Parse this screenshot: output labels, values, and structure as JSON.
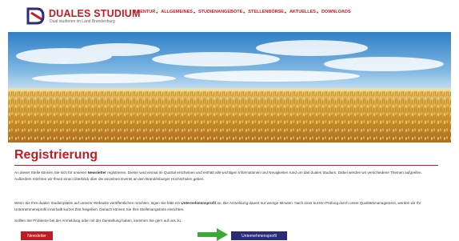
{
  "header": {
    "logo_title": "DUALES STUDIUM",
    "logo_subtitle": "Dual studieren im Land Brandenburg",
    "nav": [
      {
        "label": "AGENTUR",
        "dropdown": true
      },
      {
        "label": "ALLGEMEINES",
        "dropdown": true
      },
      {
        "label": "STUDIENANGEBOTE",
        "dropdown": true
      },
      {
        "label": "STELLENBÖRSE",
        "dropdown": true
      },
      {
        "label": "AKTUELLES",
        "dropdown": true
      },
      {
        "label": "DOWNLOADS",
        "dropdown": false
      }
    ]
  },
  "main": {
    "title": "Registrierung",
    "p1_a": "An dieser Stelle können Sie sich für unseren ",
    "p1_b": "Newsletter",
    "p1_c": " registrieren. Dieser wird einmal im Quartal erscheinen und enthält alle wichtigen Informationen und Neuigkeiten rund um das duales Studium. Dabei werden wir verschiedene Themen aufgreifen. Außerdem möchten wir Ihnen einen Überblick über die einzelnen Events an den Brandenburger Hochschulen geben.",
    "p2_a": "Wenn Sie Ihre dualen Studienplätze auf unserer Webseite veröffentlichen möchten, legen Sie bitte ein ",
    "p2_b": "Unternehmensprofil",
    "p2_c": " an. Die Anmeldung dauert nur wenige Minuten. Nach einer kurzen Prüfung durch unser Qualitätsmanagement, werden wir Ihr Unternehmensprofil innerhalb kurzer Zeit freigeben. Danach können Sie Ihre Stellenangebote einrichten.",
    "p3": "Sollten Sie Probleme bei der Anmeldung oder mit der Darstellung haben, kommen Sie gern auf uns zu.",
    "newsletter_button": "Newsletter",
    "company_button": "Unternehmensprofil"
  },
  "colors": {
    "brand_red": "#c41b23",
    "button_blue": "#2a2c7a",
    "arrow_green": "#3aa935"
  }
}
